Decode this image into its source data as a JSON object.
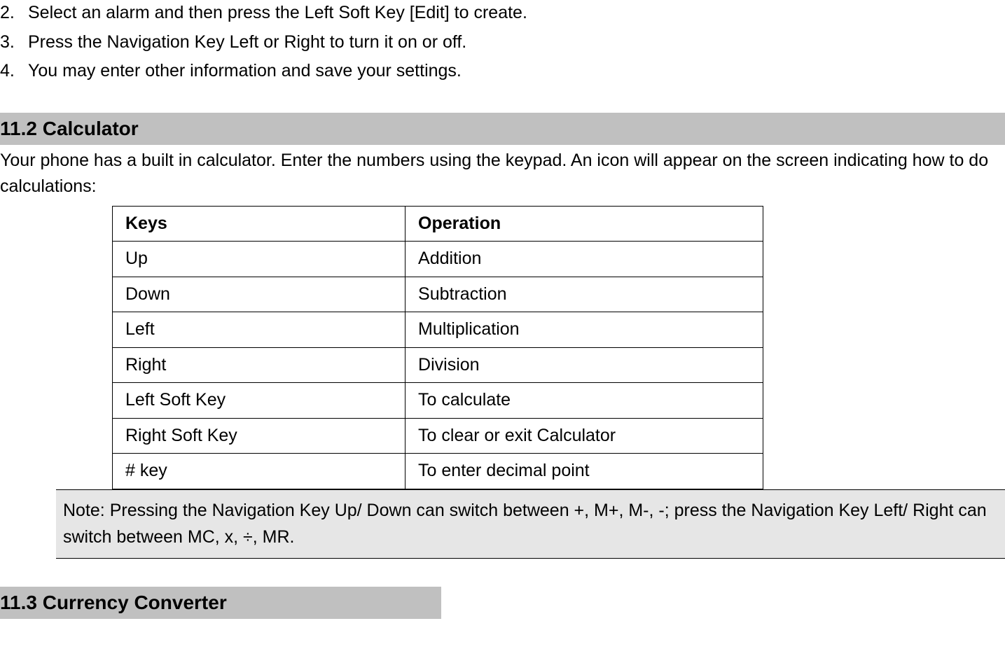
{
  "list": {
    "items": [
      {
        "number": "2.",
        "text": "Select an alarm and then press the Left Soft Key [Edit] to create."
      },
      {
        "number": "3.",
        "text": "Press the Navigation Key Left or Right to turn it on or off."
      },
      {
        "number": "4.",
        "text": "You may enter other information and save your settings."
      }
    ]
  },
  "section_11_2": {
    "number": "11.2 ",
    "title": "Calculator",
    "paragraph": "Your phone has a built in calculator. Enter the numbers using the keypad. An icon will appear on the screen indicating how to do calculations:"
  },
  "table": {
    "headers": {
      "keys": "Keys",
      "operation": "Operation"
    },
    "rows": [
      {
        "keys": "Up",
        "operation": "Addition"
      },
      {
        "keys": "Down",
        "operation": "Subtraction"
      },
      {
        "keys": "Left",
        "operation": "Multiplication"
      },
      {
        "keys": "Right",
        "operation": "Division"
      },
      {
        "keys": "Left Soft Key",
        "operation": "To calculate"
      },
      {
        "keys": "Right Soft Key",
        "operation": "To clear or exit Calculator"
      },
      {
        "keys": "# key",
        "operation": "To enter decimal point"
      }
    ]
  },
  "note": "Note: Pressing the Navigation Key Up/ Down can switch between +, M+, M-, -; press the Navigation Key Left/ Right can switch between MC, x, ÷, MR.",
  "section_11_3": {
    "number": "11.3 ",
    "title": "Currency Converter"
  }
}
